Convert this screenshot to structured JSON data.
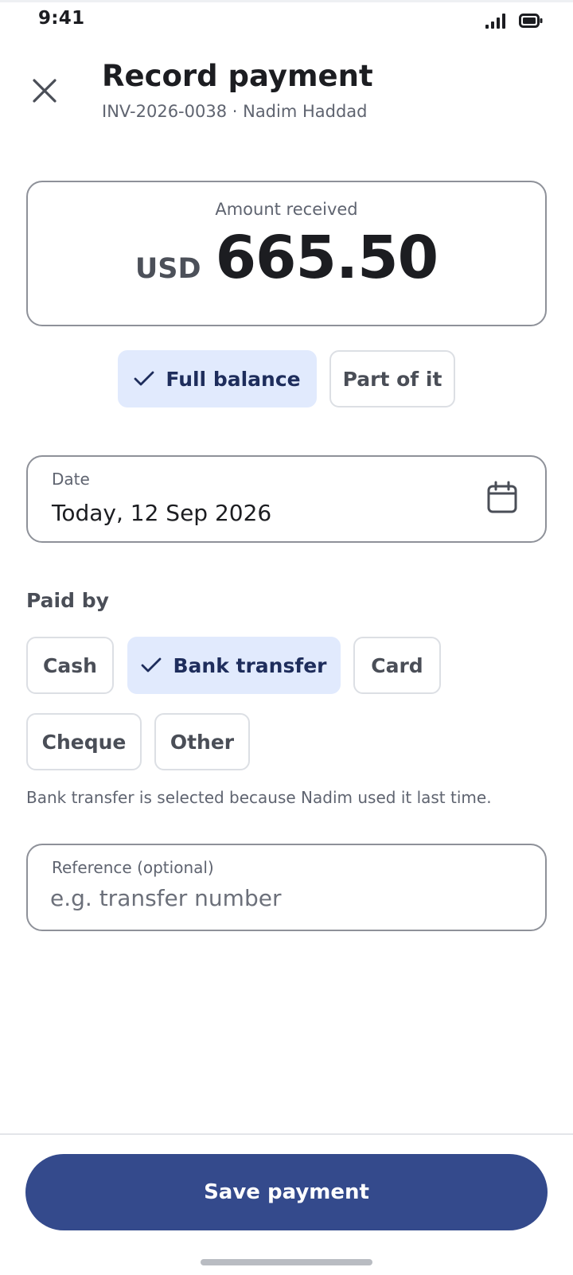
{
  "status_bar": {
    "time": "9:41",
    "signal_icon": "cellular-signal-icon",
    "battery_icon": "battery-icon"
  },
  "header": {
    "close_icon": "close-icon",
    "title": "Record payment",
    "subtitle": "INV-2026-0038 · Nadim Haddad"
  },
  "amount": {
    "label": "Amount received",
    "currency": "USD",
    "value": "665.50"
  },
  "amount_options": {
    "full_balance": "Full balance",
    "part": "Part of it",
    "selected": "full_balance"
  },
  "date_field": {
    "label": "Date",
    "value": "Today, 12 Sep 2026",
    "icon": "calendar-icon"
  },
  "paid_by": {
    "label": "Paid by",
    "methods": [
      "Cash",
      "Bank transfer",
      "Card",
      "Cheque",
      "Other"
    ],
    "selected": "Bank transfer",
    "hint": "Bank transfer is selected because Nadim used it last time."
  },
  "reference_field": {
    "label": "Reference (optional)",
    "placeholder": "e.g. transfer number",
    "value": ""
  },
  "footer": {
    "save_label": "Save payment"
  },
  "colors": {
    "primary": "#344a8c",
    "selected_chip_bg": "#e1eafd",
    "selected_chip_text": "#1e2d5c",
    "border": "#8e9199"
  }
}
